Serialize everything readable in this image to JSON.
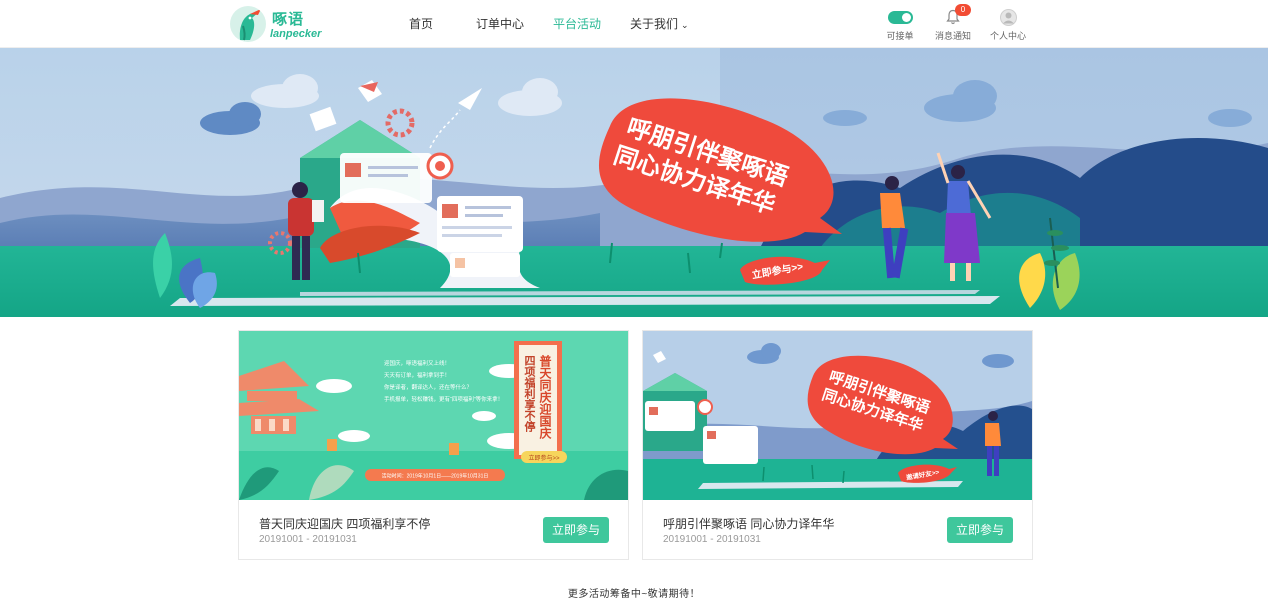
{
  "brand": {
    "name_cn": "啄语",
    "name_en": "lanpecker",
    "color": "#2ab995"
  },
  "nav": {
    "items": [
      {
        "label": "首页",
        "active": false
      },
      {
        "label": "订单中心",
        "active": false
      },
      {
        "label": "平台活动",
        "active": true
      },
      {
        "label": "关于我们",
        "active": false,
        "has_dropdown": true
      }
    ]
  },
  "utilities": {
    "accept_orders": {
      "label": "可接单",
      "icon": "toggle-icon",
      "on": true
    },
    "notifications": {
      "label": "消息通知",
      "icon": "bell-icon",
      "count": "0"
    },
    "profile": {
      "label": "个人中心",
      "icon": "avatar-icon"
    }
  },
  "banner": {
    "headline_line1": "呼朋引伴聚啄语",
    "headline_line2": "同心协力译年华",
    "cta": "立即参与>>",
    "active_slide": 2,
    "slide_count": 2
  },
  "activities": [
    {
      "title": "普天同庆迎国庆 四项福利享不停",
      "date": "20191001 - 20191031",
      "button": "立即参与",
      "poster": {
        "vertical_title": "普天同庆迎国庆",
        "vertical_subtitle": "四项福利享不停",
        "lines": [
          "迎国庆，啄语福利又上线！",
          "天天有订单，福利拿到手！",
          "你是译者，翻译达人，还在等什么？",
          "手机报单，轻松赚钱，更有“四项福利”等你来拿！"
        ],
        "period": "活动时间：2019年10月1日——2019年10月31日",
        "cta": "立即参与>>"
      }
    },
    {
      "title": "呼朋引伴聚啄语 同心协力译年华",
      "date": "20191001 - 20191031",
      "button": "立即参与",
      "poster": {
        "headline_line1": "呼朋引伴聚啄语",
        "headline_line2": "同心协力译年华",
        "cta": "邀请好友>>"
      }
    }
  ],
  "footer_note": "更多活动筹备中~敬请期待！",
  "colors": {
    "accent": "#2ab995",
    "button": "#3fc79c",
    "badge": "#f24c33",
    "bubble": "#ef4a3c",
    "banner_sky": "#a9c6e2",
    "banner_grass": "#1eb394"
  }
}
